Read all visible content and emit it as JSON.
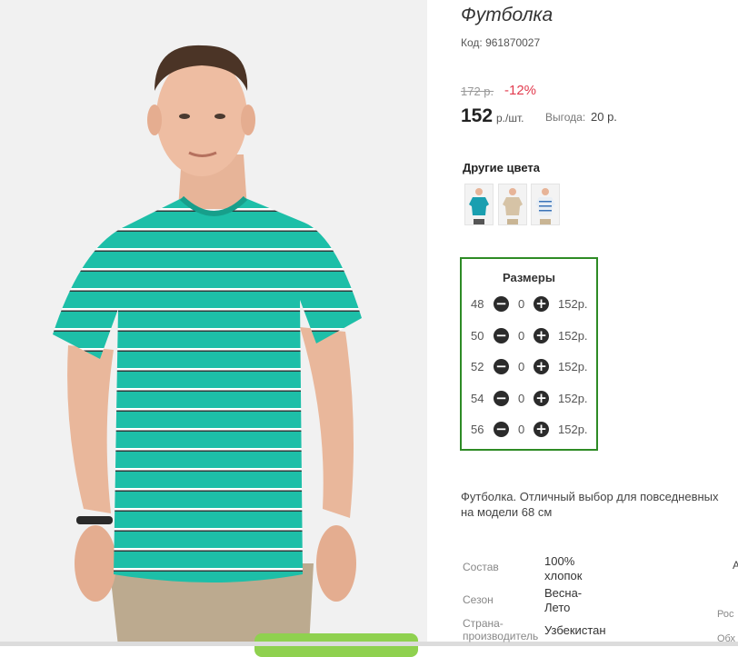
{
  "product": {
    "title": "Футболка",
    "code": "Код: 961870027",
    "old_price": "172 р.",
    "discount": "-12%",
    "price": "152",
    "price_unit": "р./шт.",
    "benefit_label": "Выгода:",
    "benefit_value": "20 р."
  },
  "colors": {
    "heading": "Другие цвета",
    "items": [
      {
        "icon": "tshirt-teal-thumbnail",
        "color": "#1a9fb0"
      },
      {
        "icon": "tshirt-beige-thumbnail",
        "color": "#d6c3a6"
      },
      {
        "icon": "tshirt-white-striped-thumbnail",
        "color": "#e8eef4"
      }
    ]
  },
  "sizes": {
    "heading": "Размеры",
    "rows": [
      {
        "size": "48",
        "qty": "0",
        "price": "152р."
      },
      {
        "size": "50",
        "qty": "0",
        "price": "152р."
      },
      {
        "size": "52",
        "qty": "0",
        "price": "152р."
      },
      {
        "size": "54",
        "qty": "0",
        "price": "152р."
      },
      {
        "size": "56",
        "qty": "0",
        "price": "152р."
      }
    ],
    "minus_symbol": "−",
    "plus_symbol": "+"
  },
  "description": {
    "line1": "Футболка. Отличный выбор для повседневных",
    "line2": "на модели 68 см"
  },
  "properties": [
    {
      "label": "Состав",
      "value_lines": [
        "100%",
        "хлопок"
      ]
    },
    {
      "label": "Сезон",
      "value_lines": [
        "Весна-",
        "Лето"
      ]
    },
    {
      "label_lines": [
        "Страна-",
        "производитель"
      ],
      "value_lines": [
        "Узбекистан"
      ]
    }
  ],
  "edge_text": {
    "a": "А",
    "b": "Рос",
    "c": "Обх"
  },
  "colors_theme": {
    "accent_green": "#2e8b25",
    "discount_red": "#e23b4e",
    "buy_button": "#8fd14f",
    "shirt": "#1dbfa8"
  }
}
